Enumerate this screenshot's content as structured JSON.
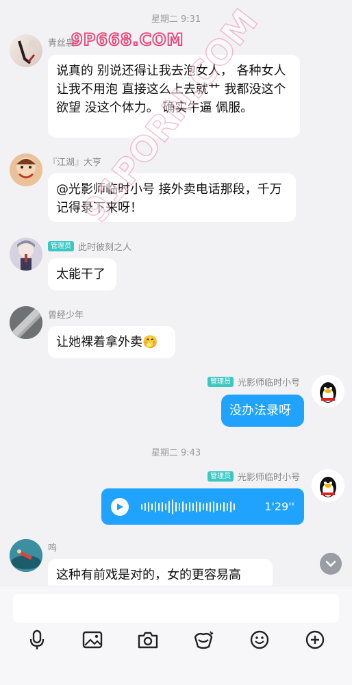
{
  "timestamps": [
    "星期二 9:31",
    "星期二 9:43"
  ],
  "watermarks": {
    "top": "9P668.COM",
    "diagonal": "91PORN.COM"
  },
  "messages": [
    {
      "sender": "青丝袅",
      "admin": false,
      "text": "说真的 别说还得让我去泡女人，   各种女人 让我不用泡 直接这么上去就艹  我都没这个欲望 没这个体力。         确实牛逼 佩服。"
    },
    {
      "sender": "『江湖』大亨",
      "admin": false,
      "text": "@光影师临时小号 接外卖电话那段，千万记得录下来呀！"
    },
    {
      "sender": "此时彼刻之人",
      "admin": true,
      "badge": "管理员",
      "text": "太能干了"
    },
    {
      "sender": "曾经少年",
      "admin": false,
      "text": "让她裸着拿外卖",
      "emoji": "🤭"
    },
    {
      "sender": "光影师临时小号",
      "admin": true,
      "badge": "管理员",
      "text": "没办法录呀",
      "mine": true
    },
    {
      "sender": "光影师临时小号",
      "admin": true,
      "badge": "管理员",
      "voice_duration": "1'29''",
      "mine": true
    },
    {
      "sender": "鸣",
      "admin": false,
      "text": "这种有前戏是对的，女的更容易高潮，"
    }
  ],
  "toolbar": [
    "microphone-icon",
    "image-icon",
    "camera-icon",
    "red-packet-icon",
    "emoji-icon",
    "plus-icon"
  ]
}
